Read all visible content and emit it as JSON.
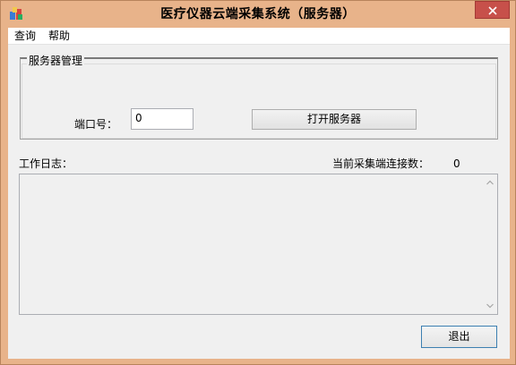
{
  "window": {
    "title": "医疗仪器云端采集系统（服务器）",
    "icons": {
      "app": "app-icon",
      "close": "close-icon"
    },
    "colors": {
      "frame": "#e8b38a",
      "close_button": "#c7504a"
    }
  },
  "menu": {
    "items": [
      {
        "label": "查询"
      },
      {
        "label": "帮助"
      }
    ]
  },
  "server_group": {
    "legend": "服务器管理",
    "port_label": "端口号：",
    "port_value": "0",
    "open_button": "打开服务器"
  },
  "log": {
    "label": "工作日志：",
    "content": "",
    "icons": {
      "scroll_up": "chevron-up-icon",
      "scroll_down": "chevron-down-icon"
    }
  },
  "connections": {
    "label": "当前采集端连接数：",
    "count": "0"
  },
  "footer": {
    "exit_button": "退出"
  }
}
